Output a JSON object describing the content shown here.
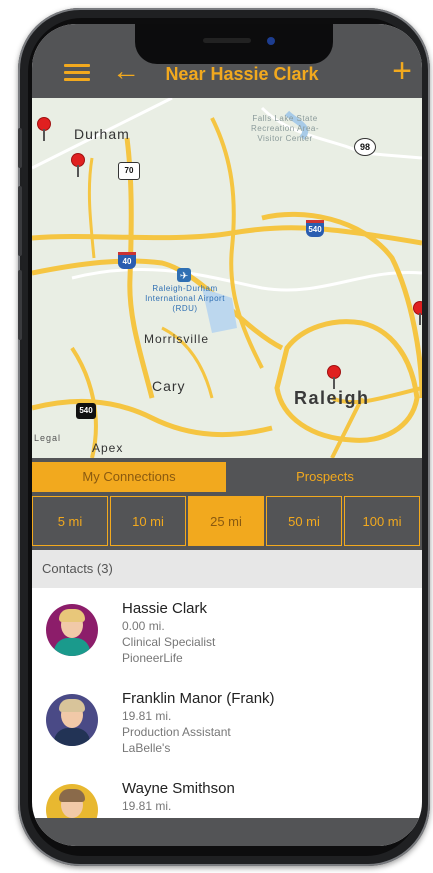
{
  "nav": {
    "title": "Near Hassie Clark",
    "menu_icon": "hamburger-icon",
    "back_icon": "arrow-left-icon",
    "add_icon": "plus-icon"
  },
  "map": {
    "labels": {
      "durham": "Durham",
      "falls_lake": "Falls Lake State Recreation Area- Visitor Center",
      "airport": "Raleigh-Durham International Airport (RDU)",
      "morrisville": "Morrisville",
      "cary": "Cary",
      "raleigh": "Raleigh",
      "apex": "Apex",
      "legal": "Legal"
    },
    "road_shields": {
      "r70": "70",
      "r98": "98",
      "i540": "540",
      "i40": "40",
      "r540": "540"
    }
  },
  "tabs": {
    "my_connections": "My Connections",
    "prospects": "Prospects"
  },
  "distances": [
    "5 mi",
    "10 mi",
    "25 mi",
    "50 mi",
    "100 mi"
  ],
  "selected_distance": "25 mi",
  "contacts_header": "Contacts (3)",
  "contacts": [
    {
      "name": "Hassie Clark",
      "distance": "0.00 mi.",
      "title": "Clinical Specialist",
      "company": "PioneerLife"
    },
    {
      "name": "Franklin Manor (Frank)",
      "distance": "19.81 mi.",
      "title": "Production Assistant",
      "company": "LaBelle's"
    },
    {
      "name": "Wayne Smithson",
      "distance": "19.81 mi."
    }
  ],
  "colors": {
    "accent": "#f2a91e",
    "bar": "#535456",
    "map_bg": "#e9eee4",
    "road": "#f5c542",
    "pin": "#e02020"
  }
}
